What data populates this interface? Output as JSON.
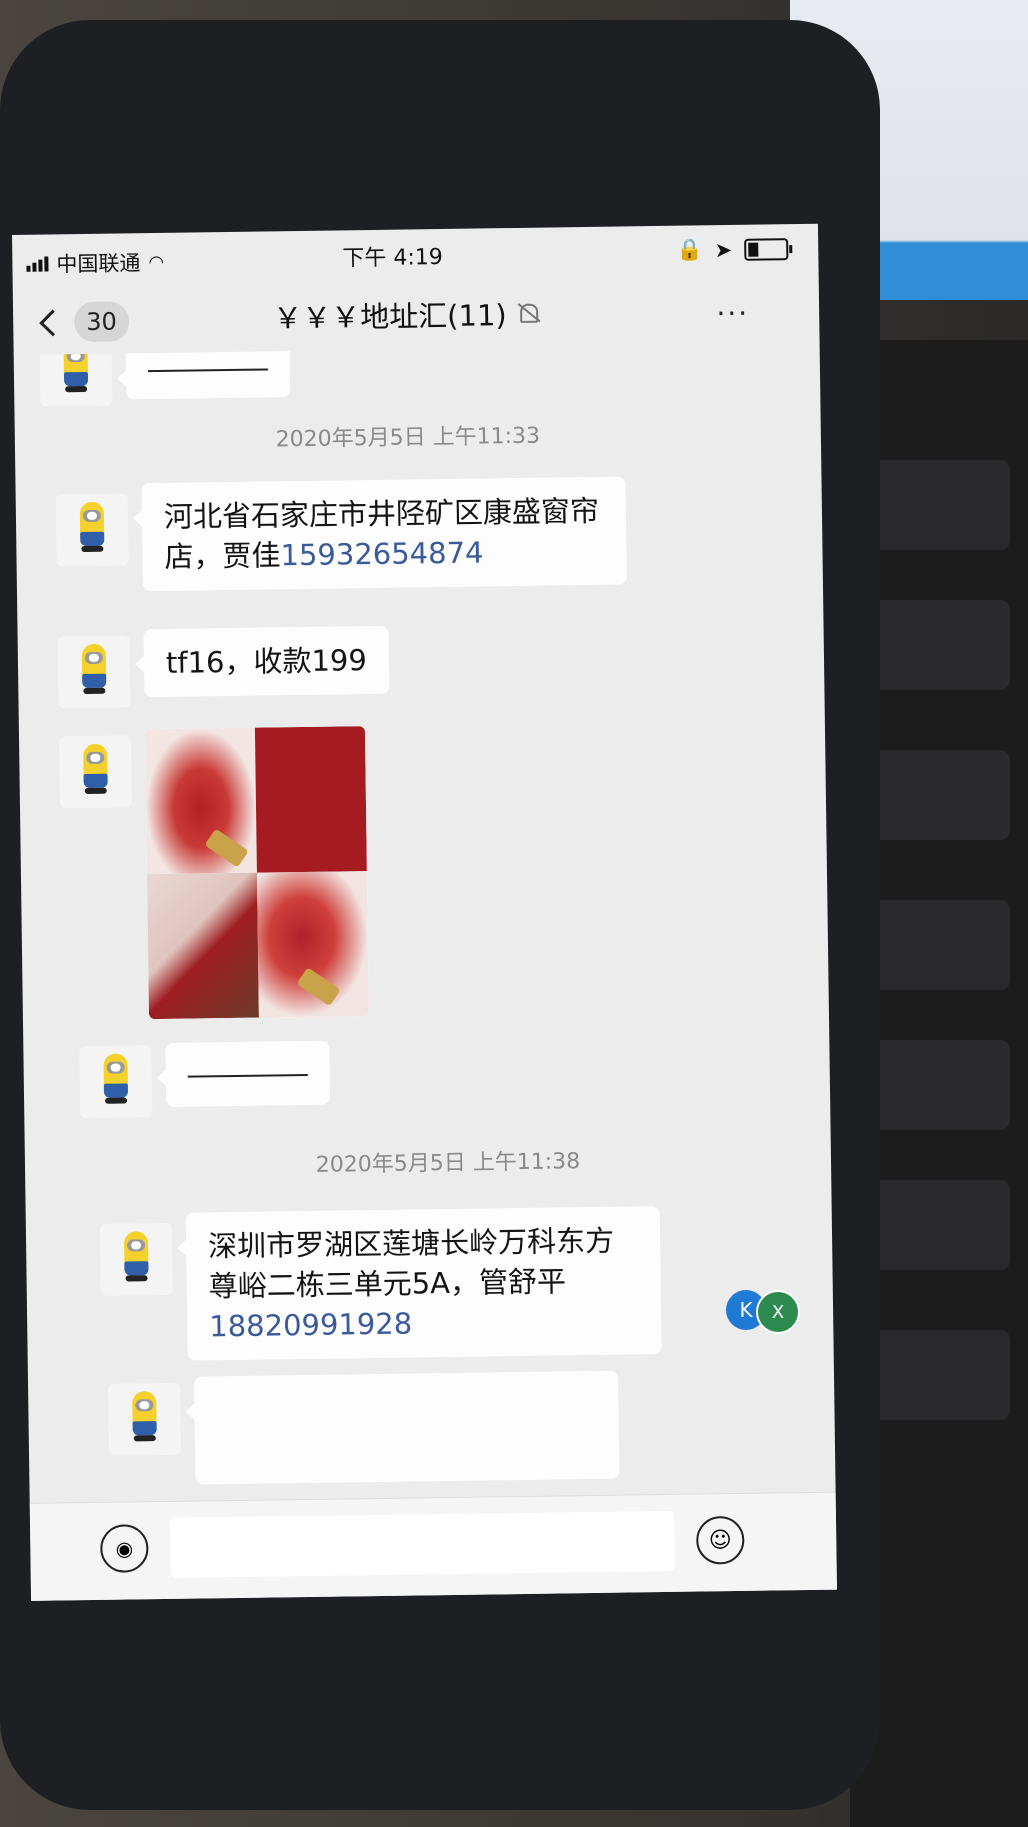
{
  "statusbar": {
    "carrier": "中国联通",
    "time": "下午 4:19"
  },
  "navbar": {
    "back_count": "30",
    "title": "￥￥￥地址汇(11)",
    "more": "···"
  },
  "chat": {
    "messages": [
      {
        "type": "text",
        "text": "————"
      },
      {
        "type": "time",
        "text": "2020年5月5日 上午11:33"
      },
      {
        "type": "text",
        "text": "河北省石家庄市井陉矿区康盛窗帘店，贾佳",
        "phone": "15932654874"
      },
      {
        "type": "text",
        "text": "tf16，收款199"
      },
      {
        "type": "image",
        "icon": "lipstick-image-icon"
      },
      {
        "type": "text",
        "text": "————"
      },
      {
        "type": "time",
        "text": "2020年5月5日 上午11:38"
      },
      {
        "type": "text",
        "text": "深圳市罗湖区莲塘长岭万科东方尊峪二栋三单元5A，管舒平",
        "phone": "18820991928"
      }
    ]
  },
  "inputbar": {
    "input_value": ""
  },
  "floating": {
    "k_label": "K",
    "x_label": "X"
  }
}
